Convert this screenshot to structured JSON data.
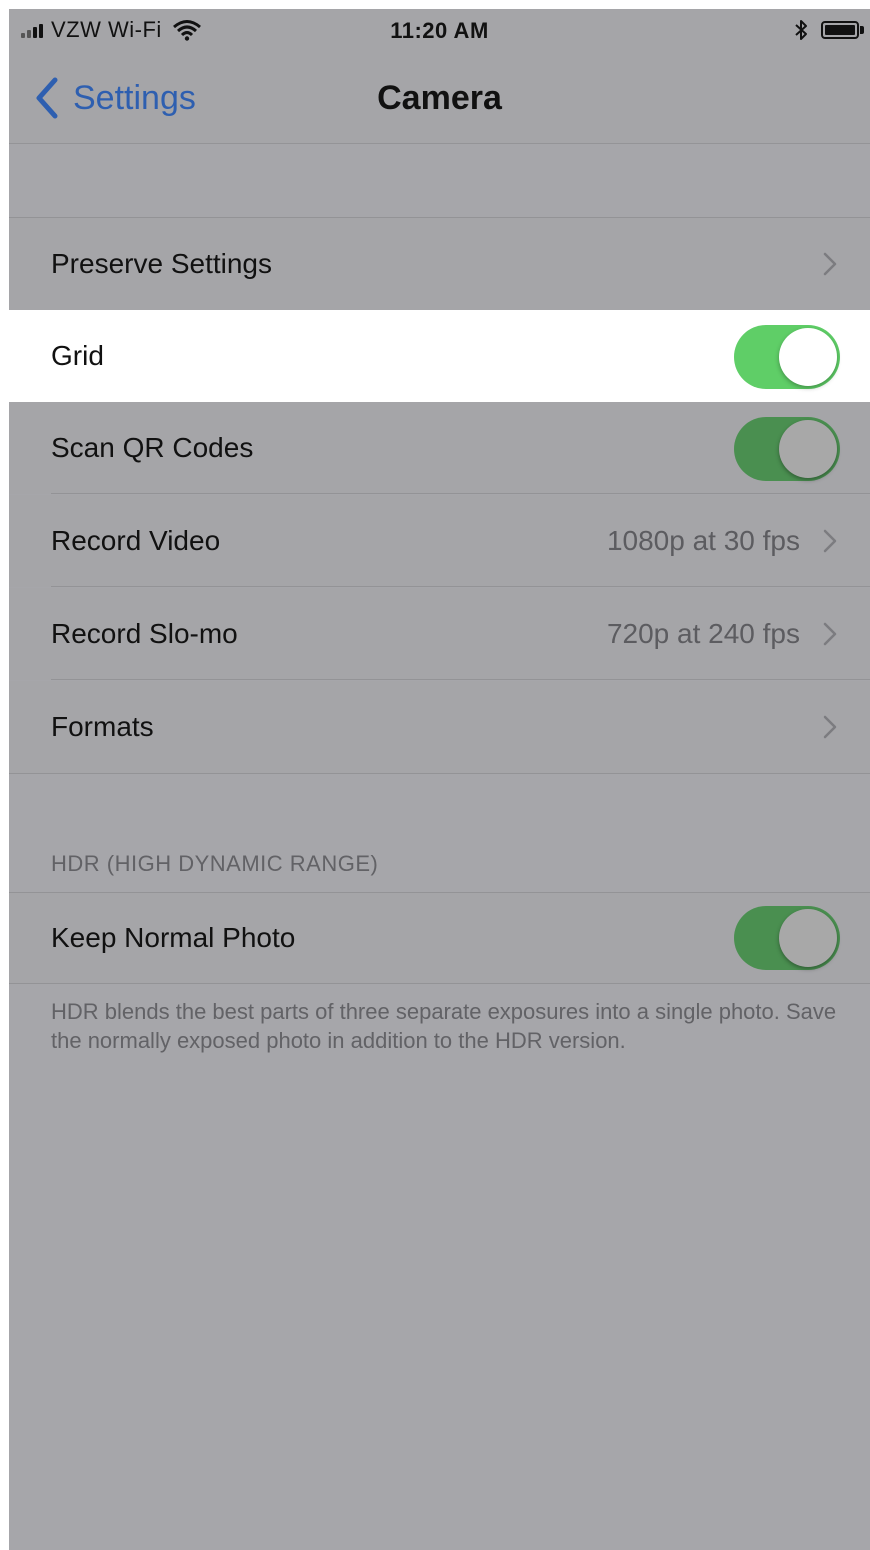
{
  "status_bar": {
    "carrier": "VZW Wi-Fi",
    "time": "11:20 AM",
    "icons": [
      "signal-bars-icon",
      "wifi-icon",
      "bluetooth-icon",
      "battery-icon"
    ]
  },
  "nav": {
    "back_label": "Settings",
    "title": "Camera"
  },
  "rows": [
    {
      "label": "Preserve Settings",
      "control": "chevron"
    },
    {
      "label": "Grid",
      "control": "toggle",
      "on": true,
      "highlighted": true
    },
    {
      "label": "Scan QR Codes",
      "control": "toggle",
      "on": true
    },
    {
      "label": "Record Video",
      "value": "1080p at 30 fps",
      "control": "chevron"
    },
    {
      "label": "Record Slo-mo",
      "value": "720p at 240 fps",
      "control": "chevron"
    },
    {
      "label": "Formats",
      "control": "chevron"
    }
  ],
  "hdr_section": {
    "header": "HDR (HIGH DYNAMIC RANGE)",
    "row": {
      "label": "Keep Normal Photo",
      "control": "toggle",
      "on": true
    },
    "footer": "HDR blends the best parts of three separate exposures into a single photo. Save the normally exposed photo in addition to the HDR version."
  },
  "colors": {
    "accent_blue": "#2e5fb0",
    "toggle_on": "#5fce67",
    "toggle_on_dimmed": "#4a8f50",
    "dim_background": "#a6a6aa"
  }
}
